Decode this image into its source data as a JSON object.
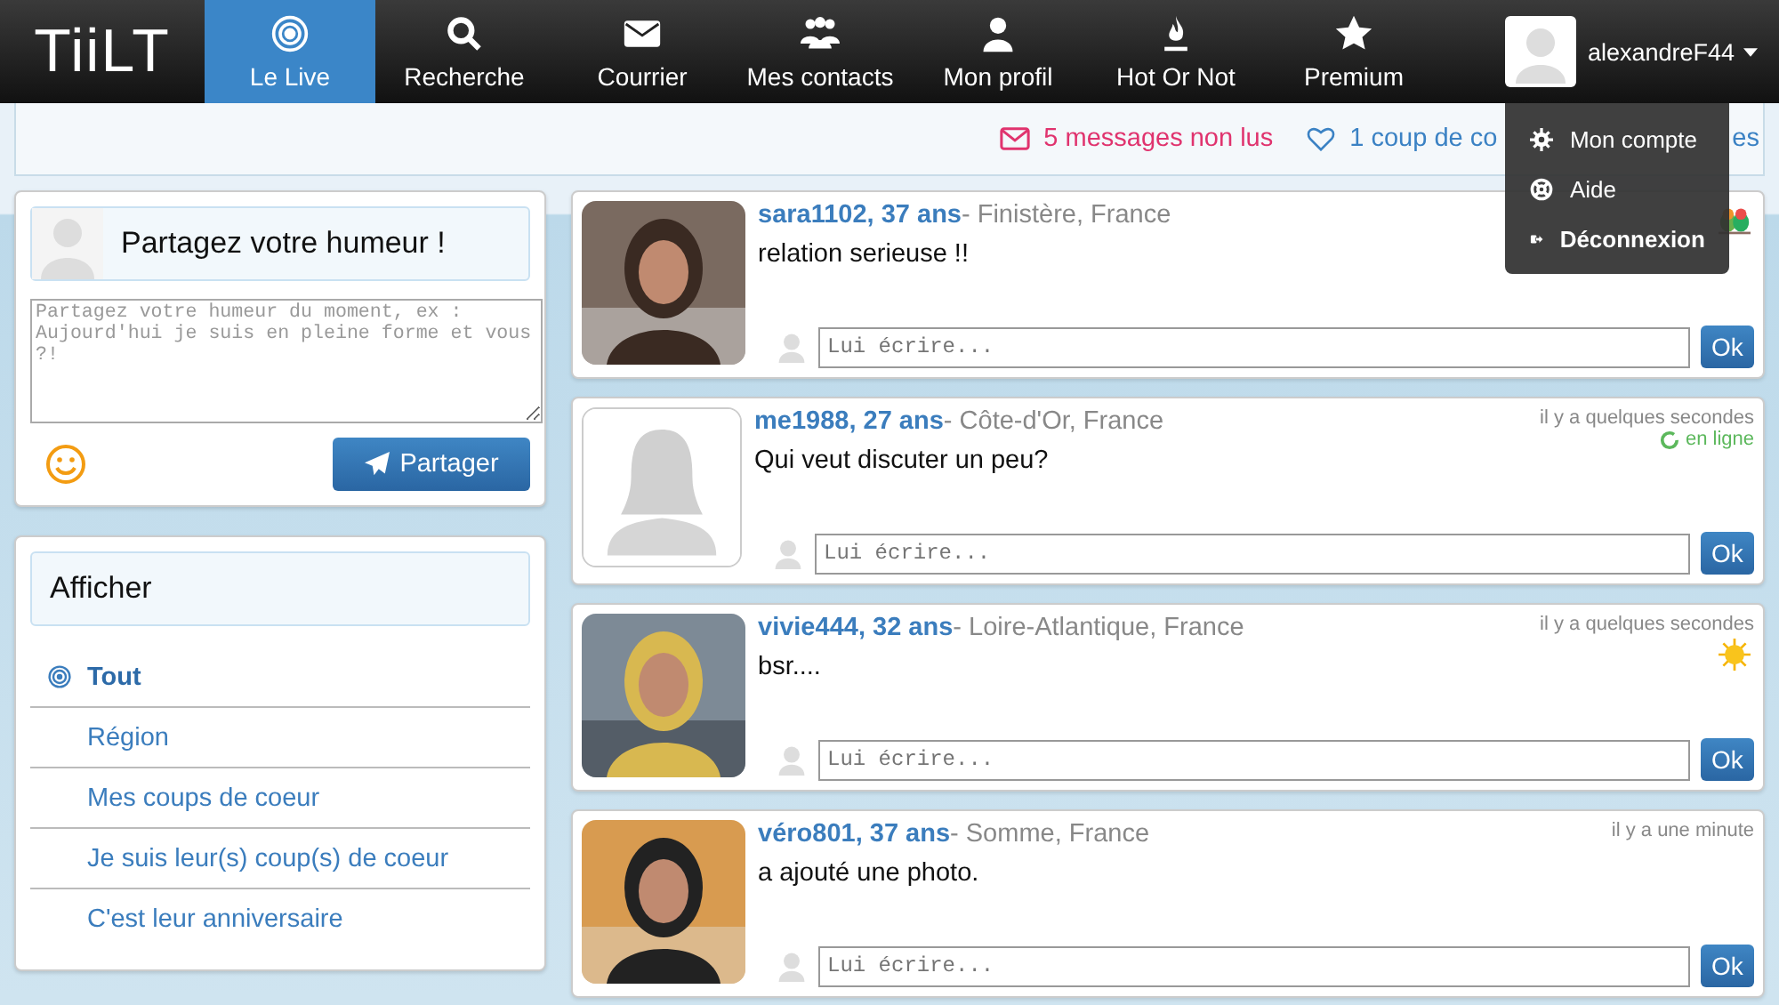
{
  "nav": {
    "logo": "TiiLT",
    "items": [
      {
        "label": "Le Live",
        "kind": "target",
        "selected": true
      },
      {
        "label": "Recherche",
        "kind": "search",
        "selected": false
      },
      {
        "label": "Courrier",
        "kind": "mail",
        "selected": false
      },
      {
        "label": "Mes contacts",
        "kind": "group",
        "selected": false
      },
      {
        "label": "Mon profil",
        "kind": "person",
        "selected": false
      },
      {
        "label": "Hot Or Not",
        "kind": "flame",
        "selected": false
      },
      {
        "label": "Premium",
        "kind": "star",
        "selected": false
      }
    ],
    "user": {
      "name": "alexandreF44",
      "menu_open": true,
      "menu": [
        {
          "label": "Mon compte",
          "kind": "gear"
        },
        {
          "label": "Aide",
          "kind": "lifebuoy"
        },
        {
          "label": "Déconnexion",
          "kind": "logout"
        }
      ]
    }
  },
  "notifications": [
    {
      "kind": "mail",
      "text": "5 messages non lus"
    },
    {
      "kind": "heart",
      "text": "1 coup de co"
    },
    {
      "kind": "tail",
      "text": "es"
    }
  ],
  "mood": {
    "title": "Partagez votre humeur !",
    "placeholder": "Partagez votre humeur du moment, ex : Aujourd'hui je suis en pleine forme et vous ?!",
    "button": "Partager"
  },
  "filter": {
    "title": "Afficher",
    "items": [
      {
        "label": "Tout",
        "selected": true
      },
      {
        "label": "Région",
        "selected": false
      },
      {
        "label": "Mes coups de coeur",
        "selected": false
      },
      {
        "label": "Je suis leur(s) coup(s) de coeur",
        "selected": false
      },
      {
        "label": "C'est leur anniversaire",
        "selected": false
      }
    ]
  },
  "posts": [
    {
      "name": "sara1102, 37 ans",
      "location": "- Finistère, France",
      "message": "relation serieuse !!",
      "badge": {
        "kind": "birds"
      },
      "reply_placeholder": "Lui écrire...",
      "button": "Ok"
    },
    {
      "photo": {
        "kind": "default"
      },
      "name": "me1988, 27 ans",
      "location": "- Côte-d'Or, France",
      "message": "Qui veut discuter un peu?",
      "time": "il y a quelques secondes",
      "online": true,
      "online_label": "en ligne",
      "reply_placeholder": "Lui écrire...",
      "button": "Ok"
    },
    {
      "name": "vivie444, 32 ans",
      "location": "- Loire-Atlantique, France",
      "message": "bsr....",
      "time": "il y a quelques secondes",
      "online": false,
      "badge": {
        "kind": "sun"
      },
      "reply_placeholder": "Lui écrire...",
      "button": "Ok"
    },
    {
      "name": "véro801, 37 ans",
      "location": "- Somme, France",
      "message": "a ajouté une photo.",
      "time": "il y a une minute",
      "online": false,
      "reply_placeholder": "Lui écrire...",
      "button": "Ok"
    }
  ]
}
